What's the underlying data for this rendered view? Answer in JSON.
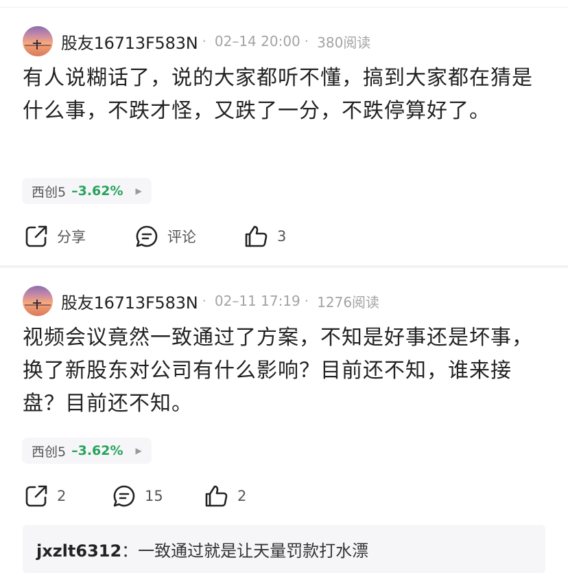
{
  "posts": [
    {
      "username": "股友16713F583N",
      "date": "02–14 20:00",
      "reads": "380阅读",
      "content": "有人说糊话了，说的大家都听不懂，搞到大家都在猜是什么事，不跌才怪，又跌了一分，不跌停算好了。",
      "stock": {
        "name": "西创5",
        "change": "–3.62%"
      },
      "actions": {
        "share": "分享",
        "comment": "评论",
        "likes": "3"
      }
    },
    {
      "username": "股友16713F583N",
      "date": "02–11 17:19",
      "reads": "1276阅读",
      "content": "视频会议竟然一致通过了方案，不知是好事还是坏事，换了新股东对公司有什么影响？目前还不知，谁来接盘？目前还不知。",
      "stock": {
        "name": "西创5",
        "change": "–3.62%"
      },
      "actions": {
        "share": "2",
        "comment": "15",
        "likes": "2"
      },
      "reply": {
        "user": "jxzlt6312",
        "sep": "：",
        "text": "一致通过就是让天量罚款打水漂"
      }
    }
  ],
  "colors": {
    "up_down": "#27a35c",
    "meta": "#a3a3a3",
    "chip_bg": "#f6f6f8"
  },
  "icons": [
    "share-icon",
    "comment-icon",
    "like-icon",
    "triangle-right-icon"
  ]
}
